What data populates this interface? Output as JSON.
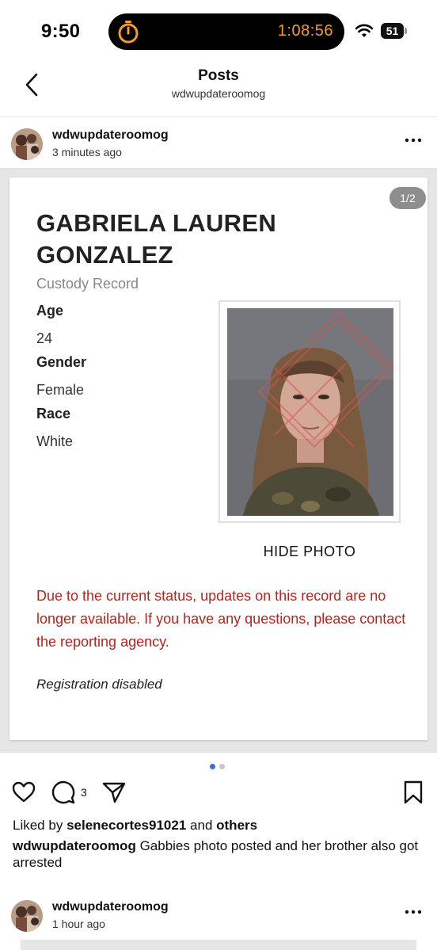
{
  "status_bar": {
    "time": "9:50",
    "timer": "1:08:56",
    "battery": "51"
  },
  "nav": {
    "title": "Posts",
    "subtitle": "wdwupdateroomog"
  },
  "post": {
    "username": "wdwupdateroomog",
    "time": "3 minutes ago",
    "carousel": {
      "label": "1/2",
      "current": 1,
      "total": 2
    },
    "record": {
      "name": "GABRIELA LAUREN GONZALEZ",
      "subtitle": "Custody Record",
      "fields": [
        {
          "label": "Age",
          "value": "24"
        },
        {
          "label": "Gender",
          "value": "Female"
        },
        {
          "label": "Race",
          "value": "White"
        }
      ],
      "hide_photo": "HIDE PHOTO",
      "notice": "Due to the current status, updates on this record are no longer available. If you have any questions, please contact the reporting agency.",
      "registration": "Registration disabled"
    },
    "actions": {
      "comment_count": "3"
    },
    "likes": {
      "prefix": "Liked by",
      "user": "selenecortes91021",
      "joiner": "and",
      "others": "others"
    },
    "caption": {
      "user": "wdwupdateroomog",
      "text": "Gabbies photo posted and her brother also got arrested"
    }
  },
  "next_post": {
    "username": "wdwupdateroomog",
    "time": "1 hour ago"
  },
  "colors": {
    "notice": "#b3261e",
    "timer": "#f49b2b",
    "dot_active": "#3b6fd6",
    "dot_inactive": "#c8c8c8"
  }
}
